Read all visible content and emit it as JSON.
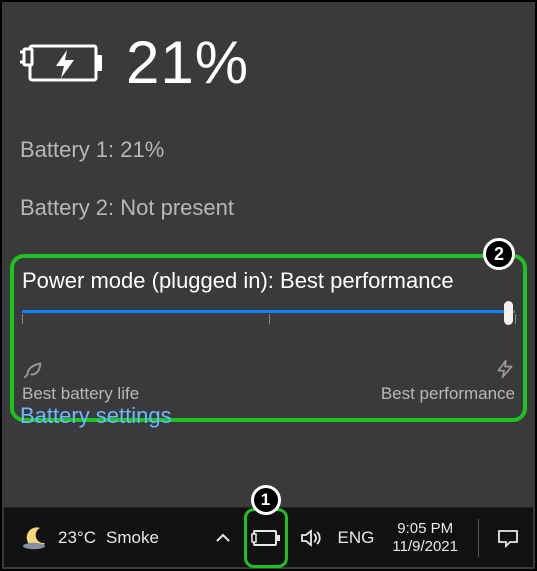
{
  "header": {
    "percent_text": "21%"
  },
  "batteries": {
    "line1": "Battery 1: 21%",
    "line2": "Battery 2: Not present"
  },
  "power_mode": {
    "label": "Power mode (plugged in): Best performance",
    "left_label": "Best battery life",
    "right_label": "Best performance",
    "slider_value": 100,
    "slider_min": 0,
    "slider_max": 100
  },
  "settings_link": "Battery settings",
  "annotations": {
    "marker1": "1",
    "marker2": "2"
  },
  "taskbar": {
    "weather_temp": "23°C",
    "weather_cond": "Smoke",
    "lang": "ENG",
    "time": "9:05 PM",
    "date": "11/9/2021"
  },
  "colors": {
    "annotation_green": "#1ec21e",
    "link_blue": "#6fb7ff",
    "slider_blue": "#0a84ff"
  }
}
